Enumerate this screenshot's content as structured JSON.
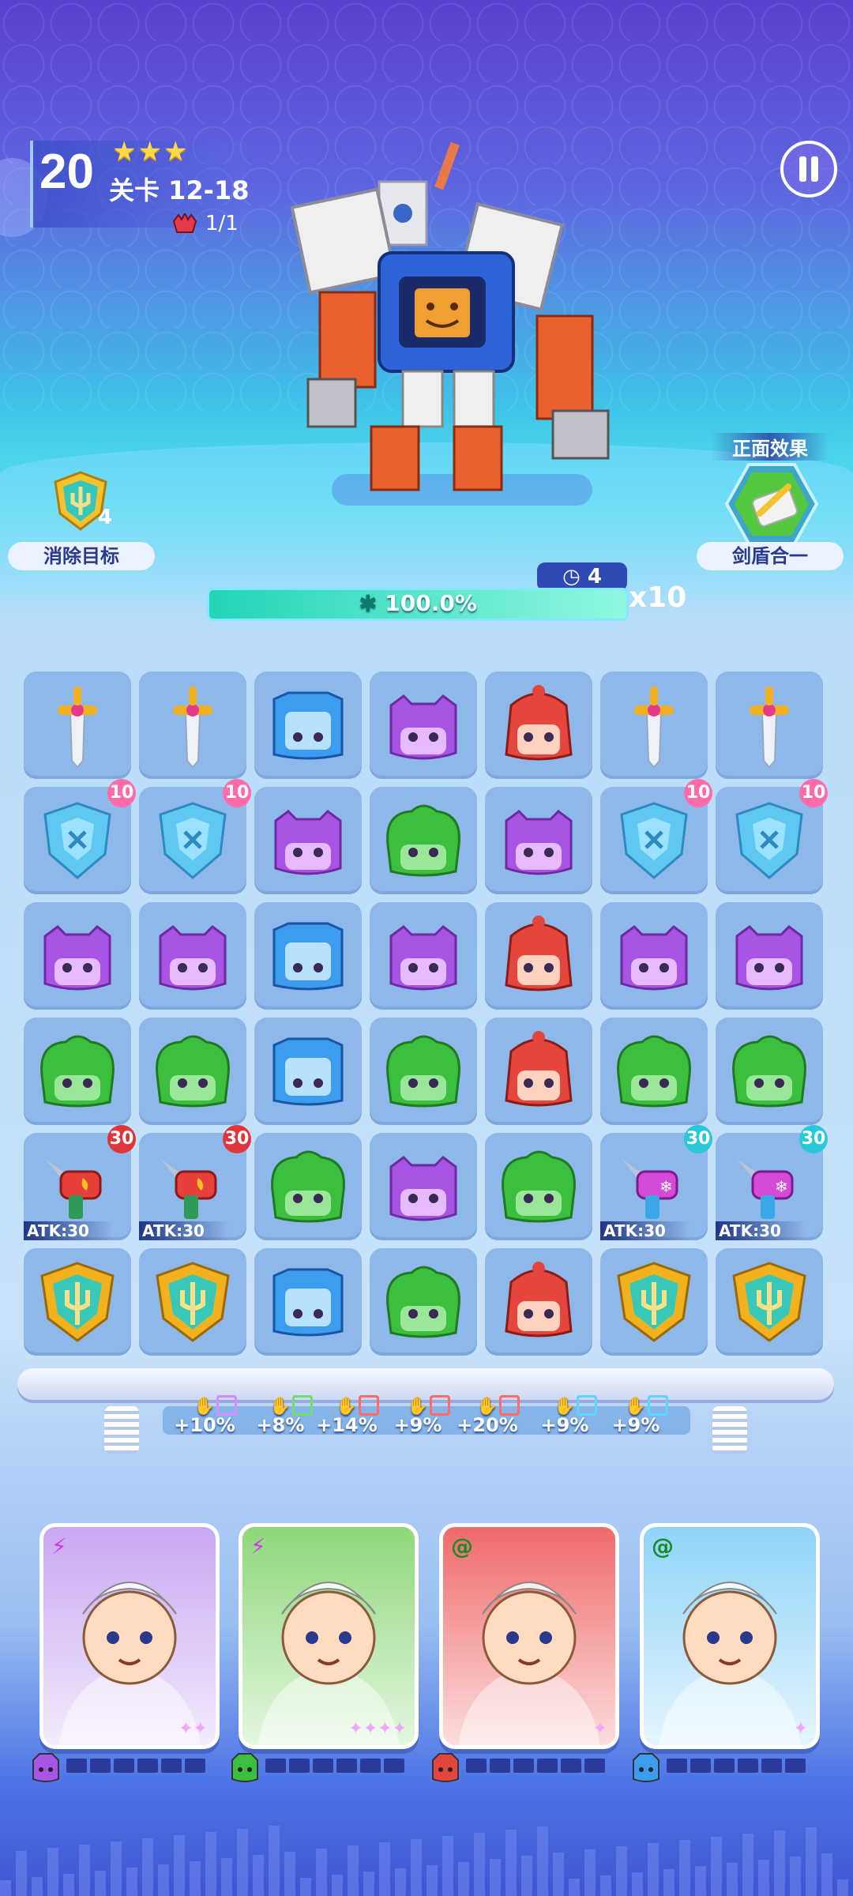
{
  "header": {
    "level_number": "20",
    "stars": "★★★",
    "stage_label": "关卡 12-18",
    "boss_count": "1/1"
  },
  "goal": {
    "count": "4",
    "label": "消除目标",
    "icon": "shield-trident-icon"
  },
  "positive_effect": {
    "title": "正面效果",
    "label": "剑盾合一",
    "icon": "sword-shield-icon"
  },
  "timer": {
    "turns": "4",
    "icon": "clock-icon"
  },
  "progress": {
    "text": "100.0%",
    "fraction": 1.0,
    "icon": "snowflake-icon"
  },
  "multiplier": "x10",
  "board": {
    "rows": [
      [
        {
          "t": "sword"
        },
        {
          "t": "sword"
        },
        {
          "t": "blue"
        },
        {
          "t": "purple"
        },
        {
          "t": "red"
        },
        {
          "t": "sword"
        },
        {
          "t": "sword"
        }
      ],
      [
        {
          "t": "shield",
          "b": "10"
        },
        {
          "t": "shield",
          "b": "10"
        },
        {
          "t": "purple"
        },
        {
          "t": "green"
        },
        {
          "t": "purple"
        },
        {
          "t": "shield",
          "b": "10"
        },
        {
          "t": "shield",
          "b": "10"
        }
      ],
      [
        {
          "t": "purple"
        },
        {
          "t": "purple"
        },
        {
          "t": "blue"
        },
        {
          "t": "purple"
        },
        {
          "t": "red"
        },
        {
          "t": "purple"
        },
        {
          "t": "purple"
        }
      ],
      [
        {
          "t": "green"
        },
        {
          "t": "green"
        },
        {
          "t": "blue"
        },
        {
          "t": "green"
        },
        {
          "t": "red"
        },
        {
          "t": "green"
        },
        {
          "t": "green"
        }
      ],
      [
        {
          "t": "firegun",
          "b": "30",
          "atk": "ATK:30"
        },
        {
          "t": "firegun",
          "b": "30",
          "atk": "ATK:30"
        },
        {
          "t": "green"
        },
        {
          "t": "purple"
        },
        {
          "t": "green"
        },
        {
          "t": "icegun",
          "b": "30",
          "atk": "ATK:30"
        },
        {
          "t": "icegun",
          "b": "30",
          "atk": "ATK:30"
        }
      ],
      [
        {
          "t": "goldshield"
        },
        {
          "t": "goldshield"
        },
        {
          "t": "blue"
        },
        {
          "t": "green"
        },
        {
          "t": "red"
        },
        {
          "t": "goldshield"
        },
        {
          "t": "goldshield"
        }
      ]
    ]
  },
  "bonuses": [
    {
      "text": "+10%",
      "color": "#d78cff"
    },
    {
      "text": "+8%",
      "color": "#6fe06f"
    },
    {
      "text": "+14%",
      "color": "#ff6a6a"
    },
    {
      "text": "+9%",
      "color": "#ff6a6a"
    },
    {
      "text": "+20%",
      "color": "#ff6a6a"
    },
    {
      "text": "+9%",
      "color": "#5fd4ff"
    },
    {
      "text": "+9%",
      "color": "#5fd4ff"
    }
  ],
  "heroes": [
    {
      "name": "skull-girl",
      "bg": "#c9a8f2",
      "element": "lightning-icon",
      "stars": "✦✦",
      "energy_icon": "purple-blob-icon"
    },
    {
      "name": "horned-girl",
      "bg": "#8ed87a",
      "element": "lightning-icon",
      "stars": "✦✦✦✦",
      "energy_icon": "green-blob-icon"
    },
    {
      "name": "opera-warrior",
      "bg": "#f06a6a",
      "element": "swirl-icon",
      "stars": "✦",
      "energy_icon": "red-blob-icon"
    },
    {
      "name": "astro-bear",
      "bg": "#8fd4f8",
      "element": "swirl-icon",
      "stars": "✦",
      "energy_icon": "blue-blob-icon"
    }
  ],
  "colors": {
    "purple": "#a855e6",
    "green": "#3cbf3f",
    "blue": "#3c9df0",
    "red": "#e4463e",
    "gold": "#f2b21f"
  }
}
